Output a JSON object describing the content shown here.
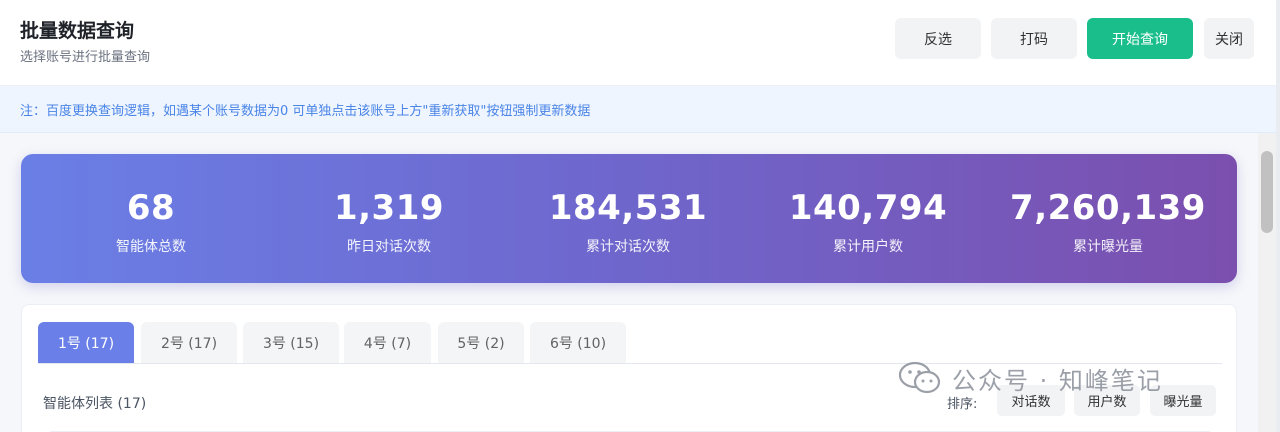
{
  "header": {
    "title": "批量数据查询",
    "subtitle": "选择账号进行批量查询",
    "buttons": {
      "invert": "反选",
      "code": "打码",
      "start": "开始查询",
      "close": "关闭"
    }
  },
  "notice": "注：百度更换查询逻辑，如遇某个账号数据为0 可单独点击该账号上方\"重新获取\"按钮强制更新数据",
  "stats": [
    {
      "value": "68",
      "label": "智能体总数"
    },
    {
      "value": "1,319",
      "label": "昨日对话次数"
    },
    {
      "value": "184,531",
      "label": "累计对话次数"
    },
    {
      "value": "140,794",
      "label": "累计用户数"
    },
    {
      "value": "7,260,139",
      "label": "累计曝光量"
    }
  ],
  "tabs": [
    {
      "label": "1号 (17)",
      "active": true
    },
    {
      "label": "2号 (17)",
      "active": false
    },
    {
      "label": "3号 (15)",
      "active": false
    },
    {
      "label": "4号 (7)",
      "active": false
    },
    {
      "label": "5号 (2)",
      "active": false
    },
    {
      "label": "6号 (10)",
      "active": false
    }
  ],
  "list": {
    "title": "智能体列表 (17)",
    "sort_label": "排序:",
    "sort_options": [
      "对话数",
      "用户数",
      "曝光量"
    ]
  },
  "watermark": "公众号 · 知峰笔记",
  "colors": {
    "primary_green": "#19be8b",
    "tab_active": "#6a80e8",
    "gradient_start": "#6a7fe6",
    "gradient_end": "#7b4fae",
    "notice_text": "#4a84e6"
  }
}
